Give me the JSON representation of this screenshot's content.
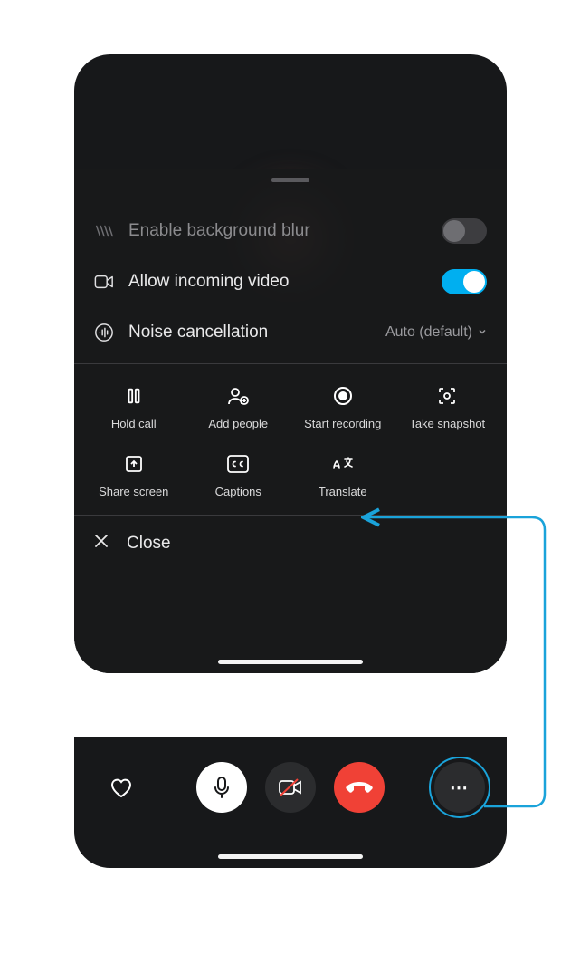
{
  "settings": {
    "blur_label": "Enable background blur",
    "incoming_video_label": "Allow incoming video",
    "noise_label": "Noise cancellation",
    "noise_value": "Auto (default)"
  },
  "actions": {
    "hold": "Hold call",
    "add": "Add people",
    "record": "Start recording",
    "snapshot": "Take snapshot",
    "share": "Share screen",
    "captions": "Captions",
    "translate": "Translate"
  },
  "close_label": "Close",
  "callbar": {
    "heart": "react",
    "mic": "mute",
    "video": "toggle video",
    "hangup": "end call",
    "more": "more"
  },
  "icons": {
    "dots": "⋯"
  }
}
